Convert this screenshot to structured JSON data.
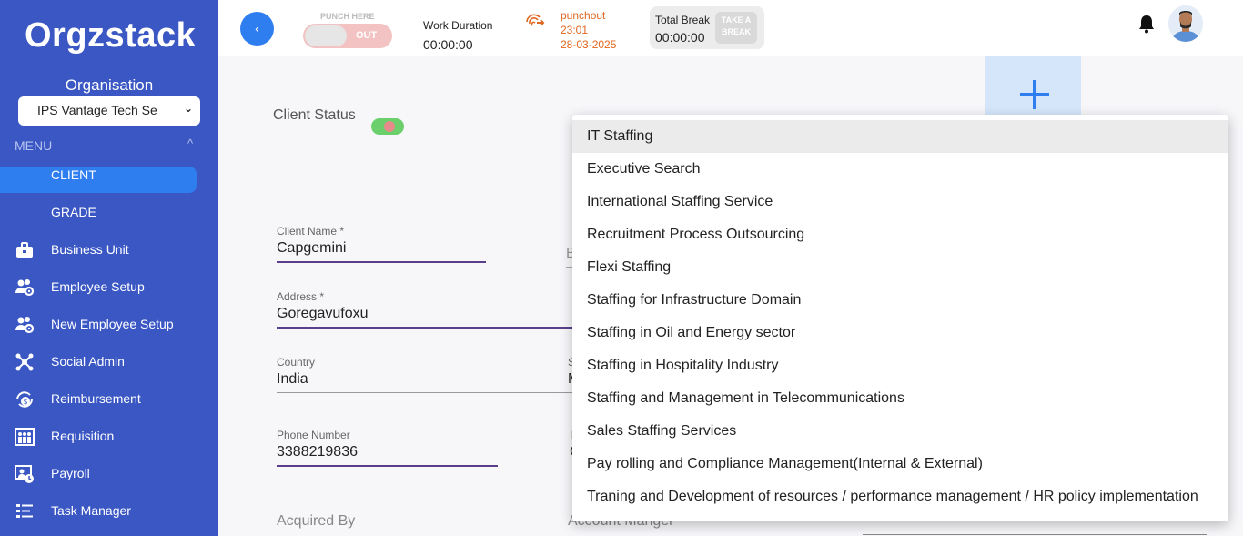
{
  "sidebar": {
    "logo": "Orgzstack",
    "org_label": "Organisation",
    "org_value": "IPS Vantage Tech Se",
    "menu_label": "MENU",
    "items": [
      {
        "label": "CLIENT",
        "icon": "none"
      },
      {
        "label": "GRADE",
        "icon": "none"
      },
      {
        "label": "Business Unit",
        "icon": "briefcase-icon"
      },
      {
        "label": "Employee Setup",
        "icon": "users-gear-icon"
      },
      {
        "label": "New Employee Setup",
        "icon": "users-gear-icon"
      },
      {
        "label": "Social Admin",
        "icon": "network-icon"
      },
      {
        "label": "Reimbursement",
        "icon": "money-cycle-icon"
      },
      {
        "label": "Requisition",
        "icon": "people-board-icon"
      },
      {
        "label": "Payroll",
        "icon": "payroll-icon"
      },
      {
        "label": "Task Manager",
        "icon": "task-list-icon"
      }
    ]
  },
  "topbar": {
    "back_label": "‹",
    "punch_here_label": "PUNCH HERE",
    "punch_toggle_text": "OUT",
    "work_duration_label": "Work Duration",
    "work_duration_value": "00:00:00",
    "punchout_label": "punchout",
    "punchout_time": "23:01",
    "punchout_date": "28-03-2025",
    "total_break_label": "Total Break",
    "total_break_value": "00:00:00",
    "take_break_label": "TAKE A BREAK"
  },
  "form": {
    "client_status_label": "Client Status",
    "client_name_label": "Client Name *",
    "client_name_value": "Capgemini",
    "second_col_partial": "B",
    "address_label": "Address *",
    "address_value": "Goregavufoxu",
    "country_label": "Country",
    "country_value": "India",
    "state_partial_label": "S",
    "state_partial_value": "M",
    "phone_label": "Phone Number",
    "phone_value": "3388219836",
    "phone_col2_partial_label": "I",
    "phone_col2_partial_value": "C",
    "acquired_by_label": "Acquired By",
    "account_manager_label": "Account Manger"
  },
  "dropdown": {
    "selected_index": 0,
    "options": [
      "IT Staffing",
      "Executive Search",
      "International Staffing Service",
      "Recruitment Process Outsourcing",
      "Flexi Staffing",
      "Staffing for Infrastructure Domain",
      "Staffing in Oil and Energy sector",
      "Staffing in Hospitality Industry",
      "Staffing and Management in Telecommunications",
      "Sales Staffing Services",
      "Pay rolling and Compliance Management(Internal & External)",
      "Traning and Development of resources / performance management / HR policy implementation"
    ]
  },
  "colors": {
    "sidebar_bg": "#3a57c4",
    "accent": "#2f7ef0",
    "punchout": "#e0661e",
    "field_underline": "#5a3f8a"
  }
}
